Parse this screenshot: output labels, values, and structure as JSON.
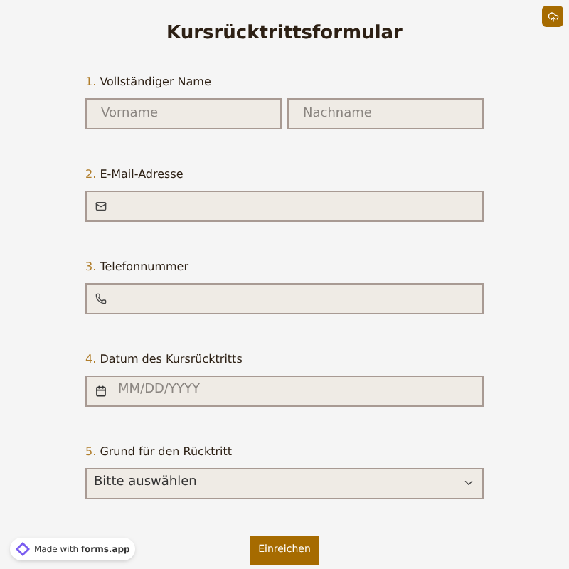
{
  "title": "Kursrücktrittsformular",
  "questions": [
    {
      "number": "1.",
      "label": "Vollständiger Name",
      "kind": "name",
      "fields": [
        {
          "placeholder": "Vorname"
        },
        {
          "placeholder": "Nachname"
        }
      ]
    },
    {
      "number": "2.",
      "label": "E-Mail-Adresse",
      "kind": "email"
    },
    {
      "number": "3.",
      "label": "Telefonnummer",
      "kind": "phone"
    },
    {
      "number": "4.",
      "label": "Datum des Kursrücktritts",
      "kind": "date",
      "placeholder": "MM/DD/YYYY"
    },
    {
      "number": "5.",
      "label": "Grund für den Rücktritt",
      "kind": "select",
      "value": "Bitte auswählen"
    }
  ],
  "submit": "Einreichen",
  "badge": "Made with **forms.app**"
}
